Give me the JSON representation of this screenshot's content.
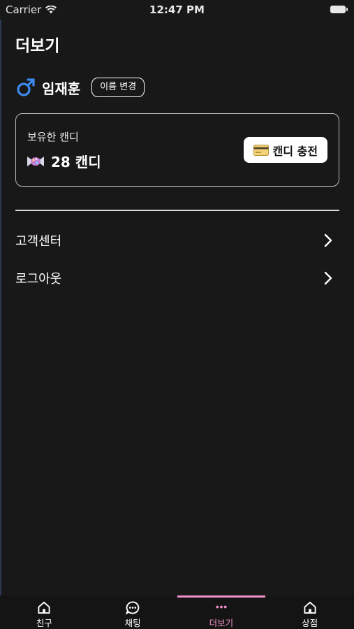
{
  "status_bar": {
    "carrier": "Carrier",
    "time": "12:47 PM"
  },
  "page": {
    "title": "더보기"
  },
  "profile": {
    "gender_icon": "male-symbol-icon",
    "name": "임재훈",
    "rename_button": "이름 변경"
  },
  "candy_card": {
    "label": "보유한 캔디",
    "amount": "28 캔디",
    "charge_button": "캔디 충전"
  },
  "menu": [
    {
      "label": "고객센터"
    },
    {
      "label": "로그아웃"
    }
  ],
  "tab_bar": {
    "tabs": [
      {
        "label": "친구",
        "icon": "home-icon",
        "active": false
      },
      {
        "label": "채팅",
        "icon": "chat-bubble-icon",
        "active": false
      },
      {
        "label": "더보기",
        "icon": "more-dots-icon",
        "active": true
      },
      {
        "label": "상점",
        "icon": "home-icon",
        "active": false
      }
    ]
  },
  "colors": {
    "background": "#181818",
    "accent": "#f08fc9",
    "male_blue": "#3d8bf0"
  }
}
